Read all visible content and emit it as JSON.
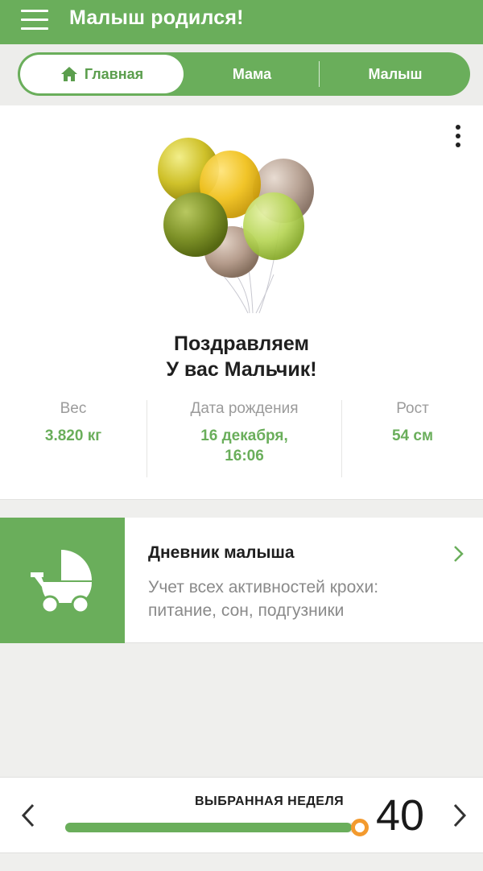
{
  "header": {
    "title": "Малыш родился!",
    "menu_icon": "hamburger-menu-icon"
  },
  "tabs": {
    "items": [
      {
        "label": "Главная",
        "icon": "home-icon",
        "active": true
      },
      {
        "label": "Мама",
        "active": false
      },
      {
        "label": "Малыш",
        "active": false
      }
    ]
  },
  "card": {
    "congrats_line1": "Поздравляем",
    "congrats_line2": "У вас Мальчик!",
    "stats": [
      {
        "label": "Вес",
        "value": "3.820 кг"
      },
      {
        "label": "Дата рождения",
        "value_line1": "16 декабря,",
        "value_line2": "16:06"
      },
      {
        "label": "Рост",
        "value": "54 см"
      }
    ]
  },
  "diary": {
    "title": "Дневник малыша",
    "desc_line1": "Учет всех активностей крохи:",
    "desc_line2": "питание, сон, подгузники",
    "icon": "baby-stroller-icon"
  },
  "week": {
    "label": "ВЫБРАННАЯ НЕДЕЛЯ",
    "value": "40",
    "progress": 1.0
  },
  "colors": {
    "accent": "#6aae5b",
    "thumb": "#f39a2e"
  }
}
